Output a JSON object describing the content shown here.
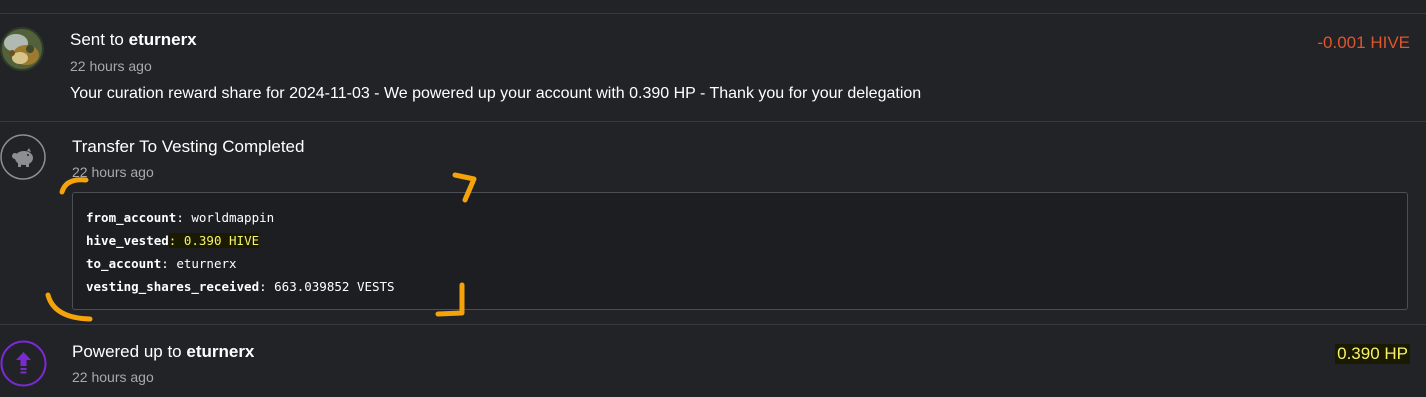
{
  "items": [
    {
      "title_prefix": "Sent to ",
      "title_user": "eturnerx",
      "time": "22 hours ago",
      "memo": "Your curation reward share for 2024-11-03 - We powered up your account with 0.390 HP - Thank you for your delegation",
      "amount": "-0.001 HIVE",
      "amount_color": "#e0552e"
    },
    {
      "title": "Transfer To Vesting Completed",
      "time": "22 hours ago",
      "icon": "piggy-bank-icon",
      "details": [
        {
          "key": "from_account",
          "value": "worldmappin"
        },
        {
          "key": "hive_vested",
          "value": "0.390 HIVE"
        },
        {
          "key": "to_account",
          "value": "eturnerx"
        },
        {
          "key": "vesting_shares_received",
          "value": "663.039852 VESTS"
        }
      ]
    },
    {
      "title_prefix": "Powered up to ",
      "title_user": "eturnerx",
      "time": "22 hours ago",
      "icon": "power-up-arrow-icon",
      "amount": "0.390 HP",
      "amount_color": "#f6f36a"
    }
  ],
  "colors": {
    "background": "#212327",
    "negative": "#e0552e",
    "highlight": "#f6f36a",
    "powerup": "#7b2ad1",
    "annotation": "#f5a30a"
  }
}
